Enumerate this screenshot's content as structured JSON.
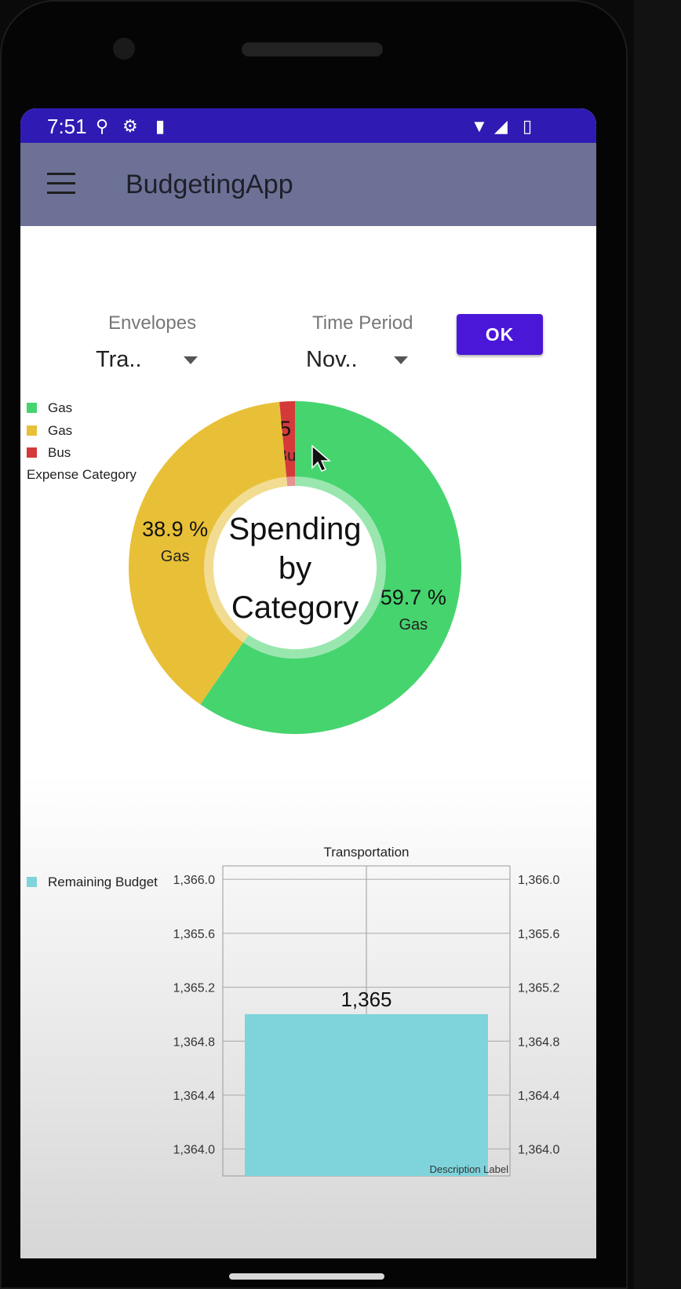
{
  "status_bar": {
    "time": "7:51"
  },
  "app_bar": {
    "title": "BudgetingApp"
  },
  "filters": {
    "envelopes": {
      "label": "Envelopes",
      "value": "Tra.."
    },
    "time_period": {
      "label": "Time Period",
      "value": "Nov.."
    },
    "ok_label": "OK"
  },
  "pie_legend": {
    "items": [
      {
        "label": "Gas",
        "color": "#46d46e"
      },
      {
        "label": "Gas",
        "color": "#e8c037"
      },
      {
        "label": "Bus",
        "color": "#d43a3a"
      }
    ],
    "title": "Expense Category"
  },
  "bar_legend": {
    "label": "Remaining Budget",
    "color": "#7fd4dc"
  },
  "colors": {
    "status_bar": "#2f1bb3",
    "app_bar": "#6c7195",
    "accent": "#4a17d8"
  },
  "chart_data": [
    {
      "type": "pie",
      "center_text": [
        "Spending",
        "by",
        "Category"
      ],
      "slices": [
        {
          "label": "Gas",
          "value": 59.7,
          "value_label": "59.7 %",
          "color": "#46d46e"
        },
        {
          "label": "Gas",
          "value": 38.9,
          "value_label": "38.9 %",
          "color": "#e8c037"
        },
        {
          "label": "Bus",
          "value": 1.5,
          "value_label": "1.5 %",
          "color": "#d43a3a"
        }
      ],
      "legend_title": "Expense Category",
      "legend_placement": "top-left"
    },
    {
      "type": "bar",
      "categories": [
        "Transportation"
      ],
      "series": [
        {
          "name": "Remaining Budget",
          "values": [
            1365
          ],
          "color": "#7fd4dc"
        }
      ],
      "value_labels": [
        "1,365"
      ],
      "ylim": [
        1363.8,
        1366.1
      ],
      "y_ticks": [
        "1,366.0",
        "1,365.6",
        "1,365.2",
        "1,364.8",
        "1,364.4",
        "1,364.0"
      ],
      "y_tick_values": [
        1366.0,
        1365.6,
        1365.2,
        1364.8,
        1364.4,
        1364.0
      ],
      "description": "Description Label",
      "grid": true,
      "legend_placement": "top-left"
    }
  ]
}
